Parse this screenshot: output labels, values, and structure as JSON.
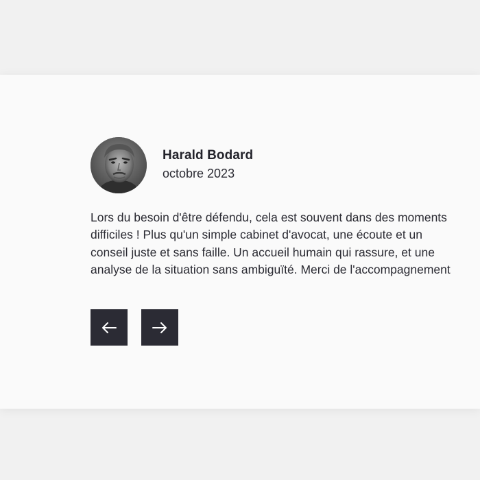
{
  "testimonial": {
    "author_name": "Harald Bodard",
    "date": "octobre 2023",
    "text_lines": [
      "Lors du besoin d'être défendu, cela est souvent dans des moments",
      "difficiles ! Plus qu'un simple cabinet d'avocat, une écoute et un",
      "conseil juste et sans faille. Un accueil humain qui rassure, et une",
      "analyse de la situation sans ambiguïté. Merci de l'accompagnement"
    ],
    "avatar_icon": "avatar-photo"
  },
  "navigation": {
    "prev_icon": "arrow-left-icon",
    "next_icon": "arrow-right-icon"
  },
  "colors": {
    "page_background": "#f1f1f1",
    "card_background": "#fafafa",
    "button_background": "#2b2b34",
    "text": "#2b2b33"
  }
}
